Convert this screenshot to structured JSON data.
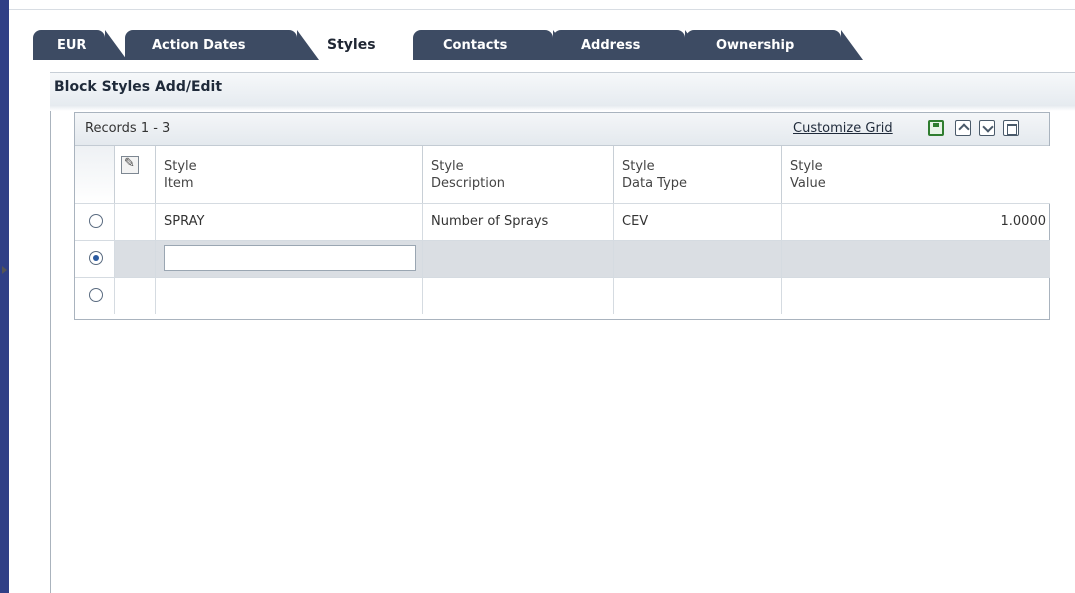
{
  "tabs": [
    {
      "label": "EUR",
      "active": false
    },
    {
      "label": "Action Dates",
      "active": false
    },
    {
      "label": "Styles",
      "active": true
    },
    {
      "label": "Contacts",
      "active": false
    },
    {
      "label": "Address",
      "active": false
    },
    {
      "label": "Ownership",
      "active": false
    }
  ],
  "section": {
    "title": "Block Styles Add/Edit"
  },
  "grid": {
    "records_label": "Records 1 - 3",
    "customize_label": "Customize Grid",
    "icons": [
      "save-icon",
      "export-icon",
      "import-icon",
      "maximize-icon"
    ],
    "row_header_icon": "pencil-icon",
    "columns": [
      {
        "line1": "Style",
        "line2": "Item"
      },
      {
        "line1": "Style",
        "line2": "Description"
      },
      {
        "line1": "Style",
        "line2": "Data Type"
      },
      {
        "line1": "Style",
        "line2": "Value"
      }
    ],
    "rows": [
      {
        "item": "SPRAY",
        "description": "Number of Sprays",
        "data_type": "CEV",
        "value": "1.0000",
        "selected": false
      },
      {
        "item": "",
        "description": "",
        "data_type": "",
        "value": "",
        "selected": true
      },
      {
        "item": "",
        "description": "",
        "data_type": "",
        "value": "",
        "selected": false
      }
    ]
  },
  "colors": {
    "tab_dark": "#3d4b63",
    "left_rail": "#2f3f86",
    "selected_row": "#dadee3"
  }
}
